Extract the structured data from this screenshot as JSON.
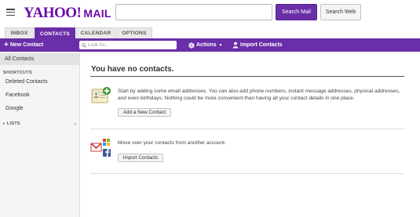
{
  "header": {
    "logo_brand": "YAHOO!",
    "logo_product": "MAIL",
    "search_placeholder": "",
    "search_mail_label": "Search Mail",
    "search_web_label": "Search Web"
  },
  "tabs": [
    {
      "label": "INBOX",
      "active": false
    },
    {
      "label": "CONTACTS",
      "active": true
    },
    {
      "label": "CALENDAR",
      "active": false
    },
    {
      "label": "OPTIONS",
      "active": false
    }
  ],
  "toolbar": {
    "new_contact_label": "New Contact",
    "lookup_placeholder": "Look for...",
    "actions_label": "Actions",
    "import_label": "Import Contacts"
  },
  "sidebar": {
    "all_contacts": "All Contacts",
    "shortcuts_heading": "SHORTCUTS",
    "shortcuts": [
      "Deleted Contacts",
      "Facebook",
      "Google"
    ],
    "lists_heading": "LISTS"
  },
  "main": {
    "title": "You have no contacts.",
    "add_description": "Start by adding some email addresses. You can also add phone numbers, instant message addresses, physical addresses, and even birthdays. Nothing could be more convenient than having all your contact details in one place.",
    "add_button": "Add a New Contact",
    "import_description": "Move over your contacts from another account.",
    "import_button": "Import Contacts"
  },
  "colors": {
    "brand_purple": "#6a2ea8"
  }
}
